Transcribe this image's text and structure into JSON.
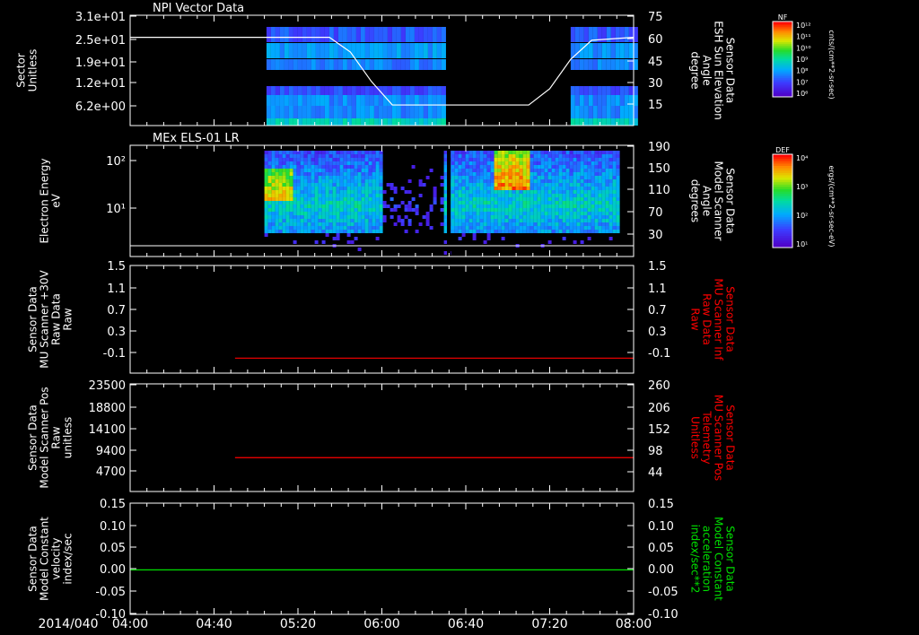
{
  "date_label": "2014/040",
  "time_ticks": [
    "04:00",
    "04:40",
    "05:20",
    "06:00",
    "06:40",
    "07:20",
    "08:00"
  ],
  "colors": {
    "background": "#000000",
    "axes": "#ffffff",
    "red_trace": "#ff0000",
    "green_trace": "#00e000"
  },
  "chart_data": [
    {
      "type": "heatmap",
      "title": "NPI Vector Data",
      "ylabel_lines": [
        "Sector",
        "Unitless"
      ],
      "yticks": [
        "3.1e+01",
        "2.5e+01",
        "1.9e+01",
        "1.2e+01",
        "6.2e+00"
      ],
      "y2label_lines": [
        "Sensor Data",
        "ESH Sun Elevation",
        "Angle",
        "degree"
      ],
      "y2ticks": [
        "75",
        "60",
        "45",
        "30",
        "15"
      ],
      "y2lim": [
        0,
        75
      ],
      "data_intervals": [
        [
          "05:05",
          "06:29"
        ],
        [
          "07:30",
          "08:00"
        ]
      ],
      "overlay_line": {
        "name": "ESH Sun Elevation Angle",
        "x": [
          "04:00",
          "05:35",
          "05:45",
          "05:55",
          "06:05",
          "06:40",
          "07:10",
          "07:20",
          "07:30",
          "07:40",
          "08:00"
        ],
        "y": [
          60,
          60,
          50,
          30,
          14,
          14,
          14,
          25,
          45,
          58,
          60
        ]
      },
      "colorbar": {
        "label": "NF",
        "units": "cnts/(cm**2-sr-sec)",
        "ticks": [
          "10¹²",
          "10¹¹",
          "10¹⁰",
          "10⁹",
          "10⁸",
          "10⁷",
          "10⁶"
        ]
      }
    },
    {
      "type": "heatmap",
      "title": "MEx ELS-01 LR",
      "ylabel_lines": [
        "Electron Energy",
        "eV"
      ],
      "yticks": [
        "10²",
        "10¹"
      ],
      "y2label_lines": [
        "Sensor Data",
        "Model Scanner",
        "Angle",
        "degrees"
      ],
      "y2ticks": [
        "190",
        "150",
        "110",
        "70",
        "30"
      ],
      "data_interval": [
        "05:04",
        "07:53"
      ],
      "overlay_line": {
        "name": "Model Scanner Angle",
        "x": [
          "04:00",
          "08:00"
        ],
        "y": [
          10,
          10
        ]
      },
      "colorbar": {
        "label": "DEF",
        "units": "ergs/(cm**2-sr-sec-eV)",
        "ticks": [
          "10⁴",
          "10³",
          "10²",
          "10¹"
        ]
      }
    },
    {
      "type": "line",
      "ylabel_lines": [
        "Sensor Data",
        "MU Scanner +30V",
        "Raw Data",
        "Raw"
      ],
      "yticks": [
        "1.5",
        "1.1",
        "0.7",
        "0.3",
        "-0.1"
      ],
      "y2label_lines": [
        "Sensor Data",
        "MU Scanner Inf",
        "Raw Data",
        "Raw"
      ],
      "y2ticks": [
        "1.5",
        "1.1",
        "0.7",
        "0.3",
        "-0.1"
      ],
      "ylim": [
        -0.3,
        1.5
      ],
      "series": [
        {
          "x": [
            "04:50",
            "08:00"
          ],
          "y": [
            -0.05,
            -0.05
          ]
        }
      ]
    },
    {
      "type": "line",
      "ylabel_lines": [
        "Sensor Data",
        "Model Scanner Pos",
        "Raw",
        "unitless"
      ],
      "yticks": [
        "23500",
        "18800",
        "14100",
        "9400",
        "4700"
      ],
      "y2label_lines": [
        "Sensor Data",
        "MU Scanner Pos",
        "Telemetry",
        "Unitless"
      ],
      "y2ticks": [
        "260",
        "206",
        "152",
        "98",
        "44"
      ],
      "ylim": [
        0,
        23500
      ],
      "series": [
        {
          "x": [
            "04:50",
            "08:00"
          ],
          "y": [
            7400,
            7400
          ]
        }
      ]
    },
    {
      "type": "line",
      "ylabel_lines": [
        "Sensor Data",
        "Model Constant",
        "velocity",
        "index/sec"
      ],
      "yticks": [
        "0.15",
        "0.10",
        "0.05",
        "0.00",
        "-0.05",
        "-0.10"
      ],
      "y2label_lines": [
        "Sensor Data",
        "Model Constant",
        "acceleration",
        "index/sec**2"
      ],
      "y2ticks": [
        "0.15",
        "0.10",
        "0.05",
        "0.00",
        "-0.05",
        "-0.10"
      ],
      "ylim": [
        -0.1,
        0.15
      ],
      "series": [
        {
          "x": [
            "04:00",
            "08:00"
          ],
          "y": [
            0.0,
            0.0
          ]
        }
      ]
    }
  ]
}
